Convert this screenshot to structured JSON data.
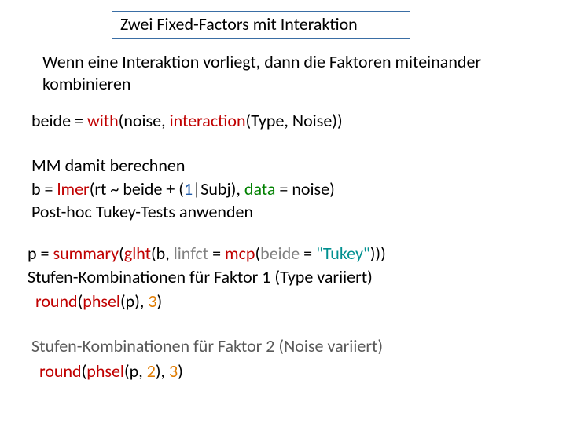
{
  "title": "Zwei Fixed-Factors mit Interaktion",
  "para1": "Wenn eine Interaktion vorliegt, dann die Faktoren miteinander kombinieren",
  "code1": {
    "lhs": "beide",
    "eq": " = ",
    "withfn": "with",
    "p1": "(noise, ",
    "interfn": "interaction",
    "p2": "(Type, Noise))"
  },
  "block2": {
    "l1": "MM damit berechnen",
    "l2": {
      "pre": " b = ",
      "lmer": "lmer",
      "arg1": "(rt ~ beide + (",
      "one": "1",
      "arg2": "|Subj), ",
      "datakw": "data",
      "arg3": " = noise)"
    },
    "l3": "Post-hoc Tukey-Tests anwenden"
  },
  "block3": {
    "l1": {
      "pre": " p = ",
      "summary": "summary",
      "p1": "(",
      "glht": "glht",
      "p2": "(b, ",
      "linfct": "linfct",
      "p3": " = ",
      "mcp": "mcp",
      "p4": "(",
      "beidekw": "beide",
      "p5": " = ",
      "tukey": "\"Tukey\"",
      "p6": ")))"
    },
    "l2": "Stufen-Kombinationen für Faktor 1 (Type variiert)",
    "l3": {
      "round": "round",
      "p1": "(",
      "phsel": "phsel",
      "p2": "(p), ",
      "three": "3",
      "p3": ")"
    }
  },
  "block4": {
    "l1": "Stufen-Kombinationen für Faktor 2 (Noise variiert)",
    "l2": {
      "round": "round",
      "p1": "(",
      "phsel": "phsel",
      "p2": "(p, ",
      "two": "2",
      "p3": "), ",
      "three": "3",
      "p4": ")"
    }
  }
}
